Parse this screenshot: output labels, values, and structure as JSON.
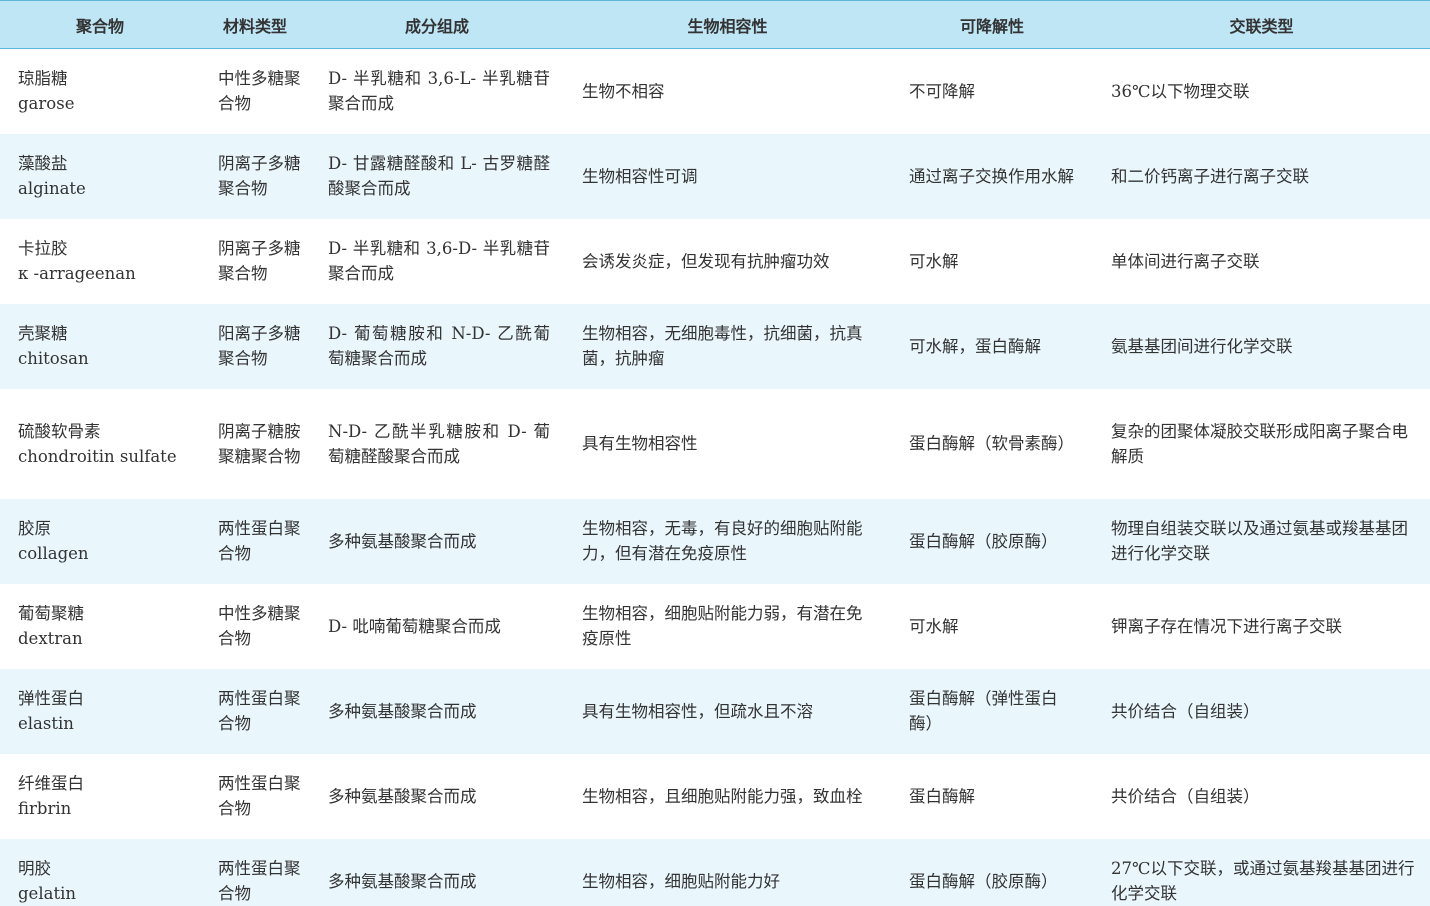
{
  "header": [
    "聚合物",
    "材料类型",
    "成分组成",
    "生物相容性",
    "可降解性",
    "交联类型"
  ],
  "rows": [
    {
      "name_zh": "琼脂糖",
      "name_en": "garose",
      "type": "中性多糖聚合物",
      "composition": "D- 半乳糖和 3,6-L- 半乳糖苷聚合而成",
      "biocompatibility": "生物不相容",
      "degradability": "不可降解",
      "crosslink": "36℃以下物理交联"
    },
    {
      "name_zh": "藻酸盐",
      "name_en": "alginate",
      "type": "阴离子多糖聚合物",
      "composition": "D- 甘露糖醛酸和 L- 古罗糖醛酸聚合而成",
      "biocompatibility": "生物相容性可调",
      "degradability": "通过离子交换作用水解",
      "crosslink": "和二价钙离子进行离子交联"
    },
    {
      "name_zh": "卡拉胶",
      "name_en": "κ -arrageenan",
      "type": "阴离子多糖聚合物",
      "composition": "D- 半乳糖和 3,6-D- 半乳糖苷聚合而成",
      "biocompatibility": "会诱发炎症，但发现有抗肿瘤功效",
      "degradability": "可水解",
      "crosslink": "单体间进行离子交联"
    },
    {
      "name_zh": "壳聚糖",
      "name_en": "chitosan",
      "type": "阳离子多糖聚合物",
      "composition": "D- 葡萄糖胺和 N-D- 乙酰葡萄糖聚合而成",
      "biocompatibility": "生物相容，无细胞毒性，抗细菌，抗真菌，抗肿瘤",
      "degradability": "可水解，蛋白酶解",
      "crosslink": "氨基基团间进行化学交联"
    },
    {
      "name_zh": "硫酸软骨素",
      "name_en": "chondroitin sulfate",
      "type": "阴离子糖胺聚糖聚合物",
      "composition": "N-D- 乙酰半乳糖胺和 D- 葡萄糖醛酸聚合而成",
      "biocompatibility": "具有生物相容性",
      "degradability": "蛋白酶解（软骨素酶）",
      "crosslink": "复杂的团聚体凝胶交联形成阳离子聚合电解质"
    },
    {
      "name_zh": "胶原",
      "name_en": "collagen",
      "type": "两性蛋白聚合物",
      "composition": "多种氨基酸聚合而成",
      "biocompatibility": "生物相容，无毒，有良好的细胞贴附能力，但有潜在免疫原性",
      "degradability": "蛋白酶解（胶原酶）",
      "crosslink": "物理自组装交联以及通过氨基或羧基基团进行化学交联"
    },
    {
      "name_zh": "葡萄聚糖",
      "name_en": "dextran",
      "type": "中性多糖聚合物",
      "composition": "D- 吡喃葡萄糖聚合而成",
      "biocompatibility": "生物相容，细胞贴附能力弱，有潜在免疫原性",
      "degradability": "可水解",
      "crosslink": "钾离子存在情况下进行离子交联"
    },
    {
      "name_zh": "弹性蛋白",
      "name_en": "elastin",
      "type": "两性蛋白聚合物",
      "composition": "多种氨基酸聚合而成",
      "biocompatibility": "具有生物相容性，但疏水且不溶",
      "degradability": "蛋白酶解（弹性蛋白酶）",
      "crosslink": "共价结合（自组装）"
    },
    {
      "name_zh": "纤维蛋白",
      "name_en": "firbrin",
      "type": "两性蛋白聚合物",
      "composition": "多种氨基酸聚合而成",
      "biocompatibility": "生物相容，且细胞贴附能力强，致血栓",
      "degradability": "蛋白酶解",
      "crosslink": "共价结合（自组装）"
    },
    {
      "name_zh": "明胶",
      "name_en": "gelatin",
      "type": "两性蛋白聚合物",
      "composition": "多种氨基酸聚合而成",
      "biocompatibility": "生物相容，细胞贴附能力好",
      "degradability": "蛋白酶解（胶原酶）",
      "crosslink": "27℃以下交联，或通过氨基羧基基团进行化学交联"
    }
  ]
}
